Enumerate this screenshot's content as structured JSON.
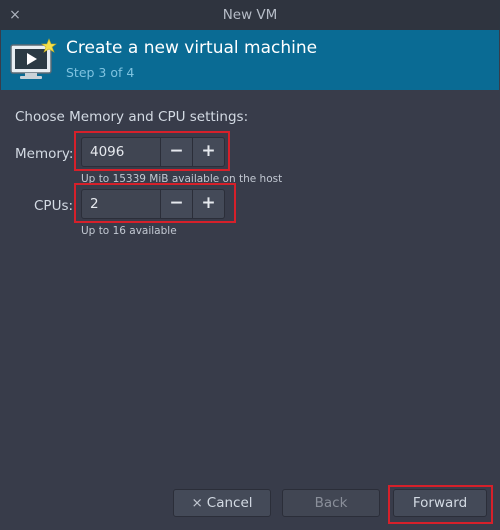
{
  "window": {
    "title": "New VM",
    "close_glyph": "×"
  },
  "header": {
    "title": "Create a new virtual machine",
    "step": "Step 3 of 4",
    "icon": "virtual-machine-icon",
    "accent_color": "#0a6b94"
  },
  "intro": "Choose Memory and CPU settings:",
  "memory": {
    "label": "Memory:",
    "value": "4096",
    "minus": "−",
    "plus": "+",
    "hint": "Up to 15339 MiB available on the host"
  },
  "cpus": {
    "label": "CPUs:",
    "value": "2",
    "minus": "−",
    "plus": "+",
    "hint": "Up to 16 available"
  },
  "buttons": {
    "cancel": "Cancel",
    "cancel_icon": "×",
    "back": "Back",
    "forward": "Forward"
  },
  "highlight_color": "#d6202a"
}
